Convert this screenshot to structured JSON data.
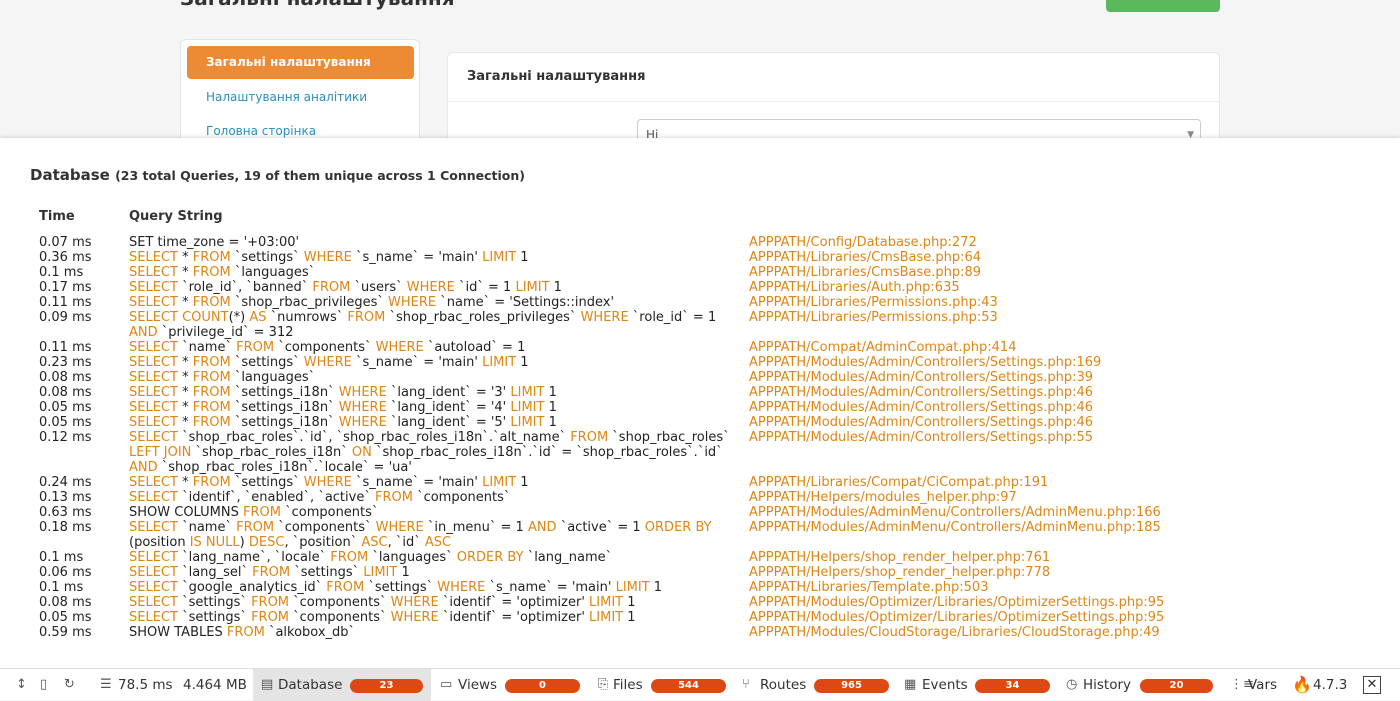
{
  "background_page": {
    "title": "Загальні налаштування",
    "sidebar": [
      {
        "label": "Загальні налаштування",
        "active": true
      },
      {
        "label": "Налаштування аналітики",
        "active": false
      },
      {
        "label": "Головна сторінка",
        "active": false
      }
    ],
    "card_title": "Загальні налаштування",
    "select_value": "Ні"
  },
  "debug": {
    "section_title": "Database",
    "section_subtitle": "(23 total Queries, 19 of them unique across 1 Connection)",
    "col_time": "Time",
    "col_query": "Query String",
    "queries": [
      {
        "time": "0.07 ms",
        "sql": "SET time_zone = '+03:00'",
        "src": "APPPATH/Config/Database.php:272"
      },
      {
        "time": "0.36 ms",
        "sql": "SELECT * FROM `settings` WHERE `s_name` = 'main' LIMIT 1",
        "src": "APPPATH/Libraries/CmsBase.php:64"
      },
      {
        "time": "0.1 ms",
        "sql": "SELECT * FROM `languages`",
        "src": "APPPATH/Libraries/CmsBase.php:89"
      },
      {
        "time": "0.17 ms",
        "sql": "SELECT `role_id`, `banned` FROM `users` WHERE `id` = 1 LIMIT 1",
        "src": "APPPATH/Libraries/Auth.php:635"
      },
      {
        "time": "0.11 ms",
        "sql": "SELECT * FROM `shop_rbac_privileges` WHERE `name` = 'Settings::index'",
        "src": "APPPATH/Libraries/Permissions.php:43"
      },
      {
        "time": "0.09 ms",
        "sql": "SELECT COUNT(*) AS `numrows` FROM `shop_rbac_roles_privileges` WHERE `role_id` = 1\nAND `privilege_id` = 312",
        "src": "APPPATH/Libraries/Permissions.php:53"
      },
      {
        "time": "0.11 ms",
        "sql": "SELECT `name` FROM `components` WHERE `autoload` = 1",
        "src": "APPPATH/Compat/AdminCompat.php:414"
      },
      {
        "time": "0.23 ms",
        "sql": "SELECT * FROM `settings` WHERE `s_name` = 'main' LIMIT 1",
        "src": "APPPATH/Modules/Admin/Controllers/Settings.php:169"
      },
      {
        "time": "0.08 ms",
        "sql": "SELECT * FROM `languages`",
        "src": "APPPATH/Modules/Admin/Controllers/Settings.php:39"
      },
      {
        "time": "0.08 ms",
        "sql": "SELECT * FROM `settings_i18n` WHERE `lang_ident` = '3' LIMIT 1",
        "src": "APPPATH/Modules/Admin/Controllers/Settings.php:46"
      },
      {
        "time": "0.05 ms",
        "sql": "SELECT * FROM `settings_i18n` WHERE `lang_ident` = '4' LIMIT 1",
        "src": "APPPATH/Modules/Admin/Controllers/Settings.php:46"
      },
      {
        "time": "0.05 ms",
        "sql": "SELECT * FROM `settings_i18n` WHERE `lang_ident` = '5' LIMIT 1",
        "src": "APPPATH/Modules/Admin/Controllers/Settings.php:46"
      },
      {
        "time": "0.12 ms",
        "sql": "SELECT `shop_rbac_roles`.`id`, `shop_rbac_roles_i18n`.`alt_name` FROM `shop_rbac_roles`\nLEFT JOIN `shop_rbac_roles_i18n` ON `shop_rbac_roles_i18n`.`id` = `shop_rbac_roles`.`id`\nAND `shop_rbac_roles_i18n`.`locale` = 'ua'",
        "src": "APPPATH/Modules/Admin/Controllers/Settings.php:55"
      },
      {
        "time": "0.24 ms",
        "sql": "SELECT * FROM `settings` WHERE `s_name` = 'main' LIMIT 1",
        "src": "APPPATH/Libraries/Compat/CiCompat.php:191"
      },
      {
        "time": "0.13 ms",
        "sql": "SELECT `identif`, `enabled`, `active` FROM `components`",
        "src": "APPPATH/Helpers/modules_helper.php:97"
      },
      {
        "time": "0.63 ms",
        "sql": "SHOW COLUMNS FROM `components`",
        "src": "APPPATH/Modules/AdminMenu/Controllers/AdminMenu.php:166"
      },
      {
        "time": "0.18 ms",
        "sql": "SELECT `name` FROM `components` WHERE `in_menu` = 1 AND `active` = 1 ORDER BY\n(position IS NULL) DESC, `position` ASC, `id` ASC",
        "src": "APPPATH/Modules/AdminMenu/Controllers/AdminMenu.php:185"
      },
      {
        "time": "0.1 ms",
        "sql": "SELECT `lang_name`, `locale` FROM `languages` ORDER BY `lang_name`",
        "src": "APPPATH/Helpers/shop_render_helper.php:761"
      },
      {
        "time": "0.06 ms",
        "sql": "SELECT `lang_sel` FROM `settings` LIMIT 1",
        "src": "APPPATH/Helpers/shop_render_helper.php:778"
      },
      {
        "time": "0.1 ms",
        "sql": "SELECT `google_analytics_id` FROM `settings` WHERE `s_name` = 'main' LIMIT 1",
        "src": "APPPATH/Libraries/Template.php:503"
      },
      {
        "time": "0.08 ms",
        "sql": "SELECT `settings` FROM `components` WHERE `identif` = 'optimizer' LIMIT 1",
        "src": "APPPATH/Modules/Optimizer/Libraries/OptimizerSettings.php:95"
      },
      {
        "time": "0.05 ms",
        "sql": "SELECT `settings` FROM `components` WHERE `identif` = 'optimizer' LIMIT 1",
        "src": "APPPATH/Modules/Optimizer/Libraries/OptimizerSettings.php:95"
      },
      {
        "time": "0.59 ms",
        "sql": "SHOW TABLES FROM `alkobox_db`",
        "src": "APPPATH/Modules/CloudStorage/Libraries/CloudStorage.php:49"
      }
    ]
  },
  "toolbar": {
    "time": "78.5 ms",
    "memory": "4.464 MB",
    "tabs": [
      {
        "label": "Database",
        "count": "23",
        "icon": "database-icon"
      },
      {
        "label": "Views",
        "count": "0",
        "icon": "views-icon"
      },
      {
        "label": "Files",
        "count": "544",
        "icon": "files-icon"
      },
      {
        "label": "Routes",
        "count": "965",
        "icon": "routes-icon"
      },
      {
        "label": "Events",
        "count": "34",
        "icon": "events-icon"
      },
      {
        "label": "History",
        "count": "20",
        "icon": "history-icon"
      }
    ],
    "vars_label": "Vars",
    "version": "4.7.3",
    "close_symbol": "✕"
  },
  "colors": {
    "keyword": "#dd8615",
    "source": "#dd8615",
    "badge": "#dd4814",
    "active_nav": "#ee8a33"
  }
}
